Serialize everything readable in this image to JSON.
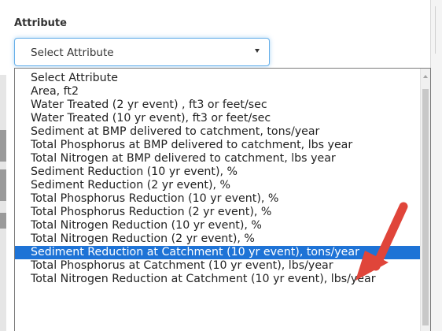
{
  "form": {
    "label": "Attribute",
    "select_value": "Select Attribute",
    "options": [
      "Select Attribute",
      "Area, ft2",
      "Water Treated (2 yr event) , ft3 or feet/sec",
      "Water Treated (10 yr event), ft3 or feet/sec",
      "Sediment at BMP delivered to catchment, tons/year",
      "Total Phosphorus at BMP delivered to catchment, lbs year",
      "Total Nitrogen at BMP delivered to catchment, lbs year",
      "Sediment Reduction (10 yr event), %",
      "Sediment Reduction (2 yr event), %",
      "Total Phosphorus Reduction (10 yr event), %",
      "Total Phosphorus Reduction (2 yr event), %",
      "Total Nitrogen Reduction (10 yr event), %",
      "Total Nitrogen Reduction (2 yr event), %",
      "Sediment Reduction at Catchment (10 yr event), tons/year",
      "Total Phosphorus at Catchment (10 yr event), lbs/year",
      "Total Nitrogen Reduction at Catchment (10 yr event), lbs/year"
    ],
    "highlighted_option": "Sediment Reduction at Catchment (10 yr event), tons/year"
  },
  "colors": {
    "highlight": "#1e73d6",
    "annotation_arrow": "#e0453a",
    "focus_border": "#66afe9"
  },
  "icons": {
    "select_caret": "caret-down-icon",
    "scroll_up": "scroll-up-arrow-icon",
    "annotation": "red-arrow-annotation"
  }
}
